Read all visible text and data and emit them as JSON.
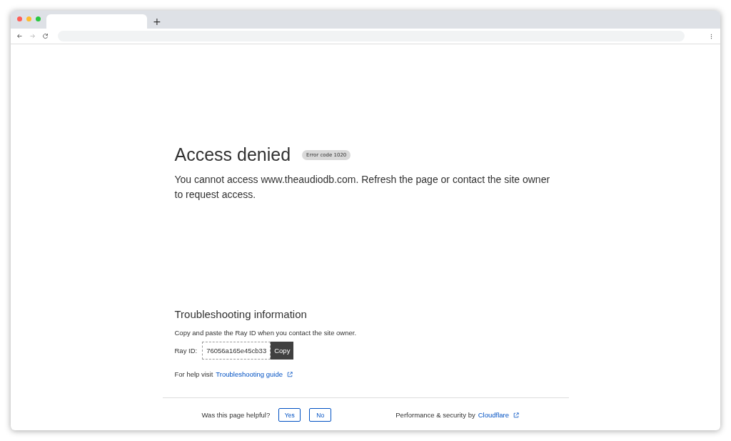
{
  "browser": {
    "new_tab": "+"
  },
  "error": {
    "title": "Access denied",
    "badge": "Error code 1020",
    "message": "You cannot access www.theaudiodb.com. Refresh the page or contact the site owner to request access."
  },
  "troubleshooting": {
    "title": "Troubleshooting information",
    "hint": "Copy and paste the Ray ID when you contact the site owner.",
    "ray_label": "Ray ID:",
    "ray_id": "76056a165e45cb33",
    "copy_button": "Copy",
    "help_text": "For help visit",
    "help_link": "Troubleshooting guide"
  },
  "footer": {
    "question": "Was this page helpful?",
    "buttons": [
      "Yes",
      "No"
    ],
    "credit": "Performance & security by",
    "credit_link": "Cloudflare"
  }
}
